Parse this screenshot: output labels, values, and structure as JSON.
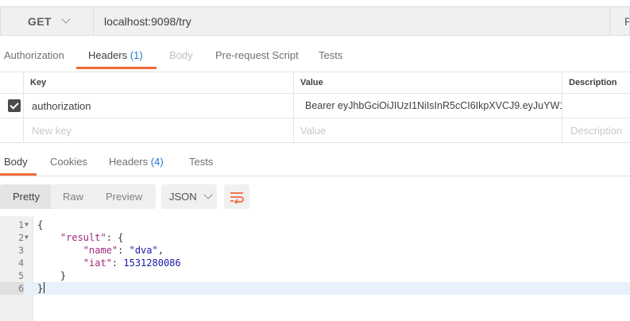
{
  "request": {
    "method": "GET",
    "url": "localhost:9098/try",
    "params_label": "P"
  },
  "request_tabs": {
    "authorization": "Authorization",
    "headers": "Headers",
    "headers_count": "(1)",
    "body": "Body",
    "pre_request": "Pre-request Script",
    "tests": "Tests"
  },
  "headers_table": {
    "columns": {
      "key": "Key",
      "value": "Value",
      "description": "Description"
    },
    "rows": [
      {
        "checked": true,
        "key": "authorization",
        "value": "Bearer eyJhbGciOiJIUzI1NiIsInR5cCI6IkpXVCJ9.eyJuYW1l..."
      }
    ],
    "new_row": {
      "key_placeholder": "New key",
      "value_placeholder": "Value",
      "description_placeholder": "Description"
    }
  },
  "response_tabs": {
    "body": "Body",
    "cookies": "Cookies",
    "headers": "Headers",
    "headers_count": "(4)",
    "tests": "Tests"
  },
  "toolbar": {
    "pretty": "Pretty",
    "raw": "Raw",
    "preview": "Preview",
    "format": "JSON"
  },
  "editor": {
    "lines": [
      {
        "num": "1",
        "fold": "▼"
      },
      {
        "num": "2",
        "fold": "▼"
      },
      {
        "num": "3",
        "fold": ""
      },
      {
        "num": "4",
        "fold": ""
      },
      {
        "num": "5",
        "fold": ""
      },
      {
        "num": "6",
        "fold": ""
      }
    ],
    "code": {
      "open_brace": "{",
      "result_key": "\"result\"",
      "name_key": "\"name\"",
      "name_value": "\"dva\"",
      "iat_key": "\"iat\"",
      "iat_value": "1531280086",
      "inner_close": "}",
      "outer_close": "}"
    }
  },
  "colors": {
    "accent": "#f26b3a",
    "count": "#1e78c8"
  }
}
